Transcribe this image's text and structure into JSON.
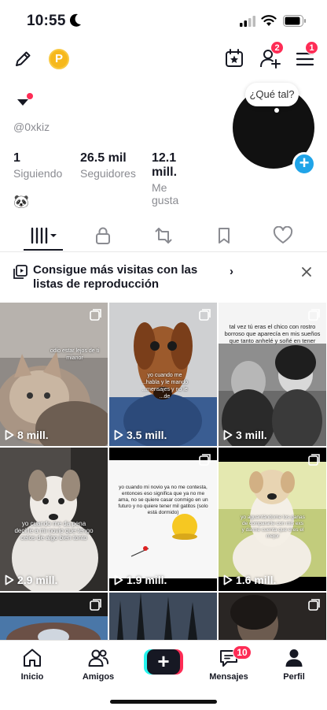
{
  "status_bar": {
    "time": "10:55"
  },
  "header": {
    "coin_label": "P",
    "friends_badge": "2",
    "menu_badge": "1"
  },
  "profile": {
    "username": "@0xkiz",
    "bio_emoji": "🐼",
    "bubble_text": "¿Qué tal?",
    "stats": [
      {
        "value": "1",
        "label": "Siguiendo"
      },
      {
        "value": "26.5 mil",
        "label": "Seguidores"
      },
      {
        "value": "12.1 mill.",
        "label": "Me gusta"
      }
    ]
  },
  "promo": {
    "text": "Consigue más visitas con las listas de reproducción",
    "chevron": "›"
  },
  "videos": [
    {
      "views": "8 mill.",
      "caption": "odio estar lejos de ti\nmianor"
    },
    {
      "views": "3.5 mill.",
      "caption": "yo cuando me ...habla\ny le mando ...mensajes\ny no le ...de"
    },
    {
      "views": "3 mill.",
      "caption": "tal vez tú eras el chico con rostro borroso que aparecía en mis sueños que tanto anhelé y soñé en tener"
    },
    {
      "views": "2.9 mill.",
      "caption": "yo cuando me da pena\ndecirle a mi novio que\ntengo celos de algo bien tonto"
    },
    {
      "views": "1.9 mill.",
      "caption": "yo cuando mi novio ya no me contesta, entonces eso significa que ya no me ama, no se quiere casar conmigo en un futuro y no quiere tener mil gatitos (solo está dormido)"
    },
    {
      "views": "1.6 mill.",
      "caption": "yo aguantándome los ganas de compararte con mis exs y darme cuenta que eres el mejor"
    }
  ],
  "bottom_nav": {
    "items": [
      "Inicio",
      "Amigos",
      "Mensajes",
      "Perfil"
    ],
    "messages_badge": "10"
  },
  "colors": {
    "accent_red": "#fe2c55",
    "accent_cyan": "#25f4ee",
    "add_blue": "#20a4e8",
    "coin_gold": "#f6b81b"
  }
}
